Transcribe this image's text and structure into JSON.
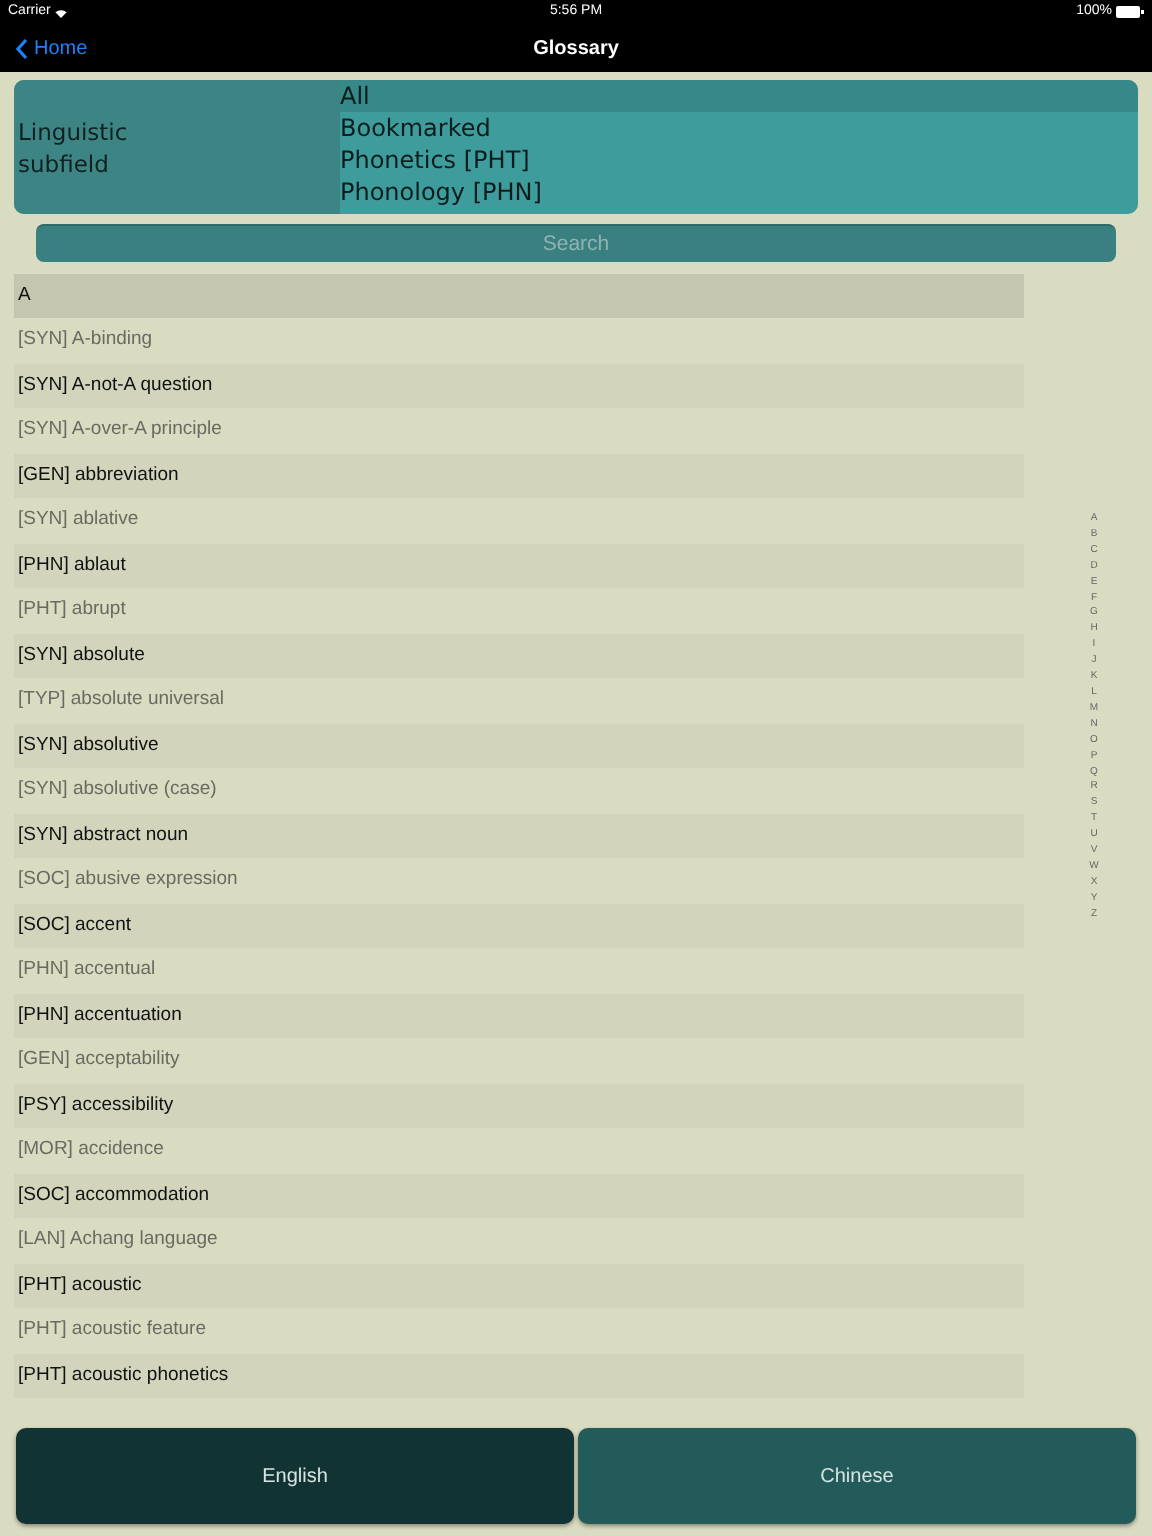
{
  "status_bar": {
    "carrier": "Carrier",
    "time": "5:56 PM",
    "battery": "100%"
  },
  "nav": {
    "back": "Home",
    "title": "Glossary"
  },
  "picker": {
    "label": "Linguistic subfield",
    "options": [
      {
        "label": "All",
        "selected": true
      },
      {
        "label": "Bookmarked",
        "selected": false
      },
      {
        "label": "Phonetics [PHT]",
        "selected": false
      },
      {
        "label": "Phonology [PHN]",
        "selected": false
      }
    ]
  },
  "search": {
    "placeholder": "Search"
  },
  "section_header": "A",
  "rows": [
    "[SYN] A-binding",
    "[SYN] A-not-A question",
    "[SYN] A-over-A principle",
    "[GEN] abbreviation",
    "[SYN] ablative",
    "[PHN] ablaut",
    "[PHT] abrupt",
    "[SYN] absolute",
    "[TYP] absolute universal",
    "[SYN] absolutive",
    "[SYN] absolutive (case)",
    "[SYN] abstract noun",
    "[SOC] abusive expression",
    "[SOC] accent",
    "[PHN] accentual",
    "[PHN] accentuation",
    "[GEN] acceptability",
    "[PSY] accessibility",
    "[MOR] accidence",
    "[SOC] accommodation",
    "[LAN] Achang language",
    "[PHT] acoustic",
    "[PHT] acoustic feature",
    "[PHT] acoustic phonetics"
  ],
  "index": [
    "A",
    "B",
    "C",
    "D",
    "E",
    "F",
    "G",
    "H",
    "I",
    "J",
    "K",
    "L",
    "M",
    "N",
    "O",
    "P",
    "Q",
    "R",
    "S",
    "T",
    "U",
    "V",
    "W",
    "X",
    "Y",
    "Z"
  ],
  "language_tabs": [
    {
      "label": "English",
      "selected": true
    },
    {
      "label": "Chinese",
      "selected": false
    }
  ]
}
